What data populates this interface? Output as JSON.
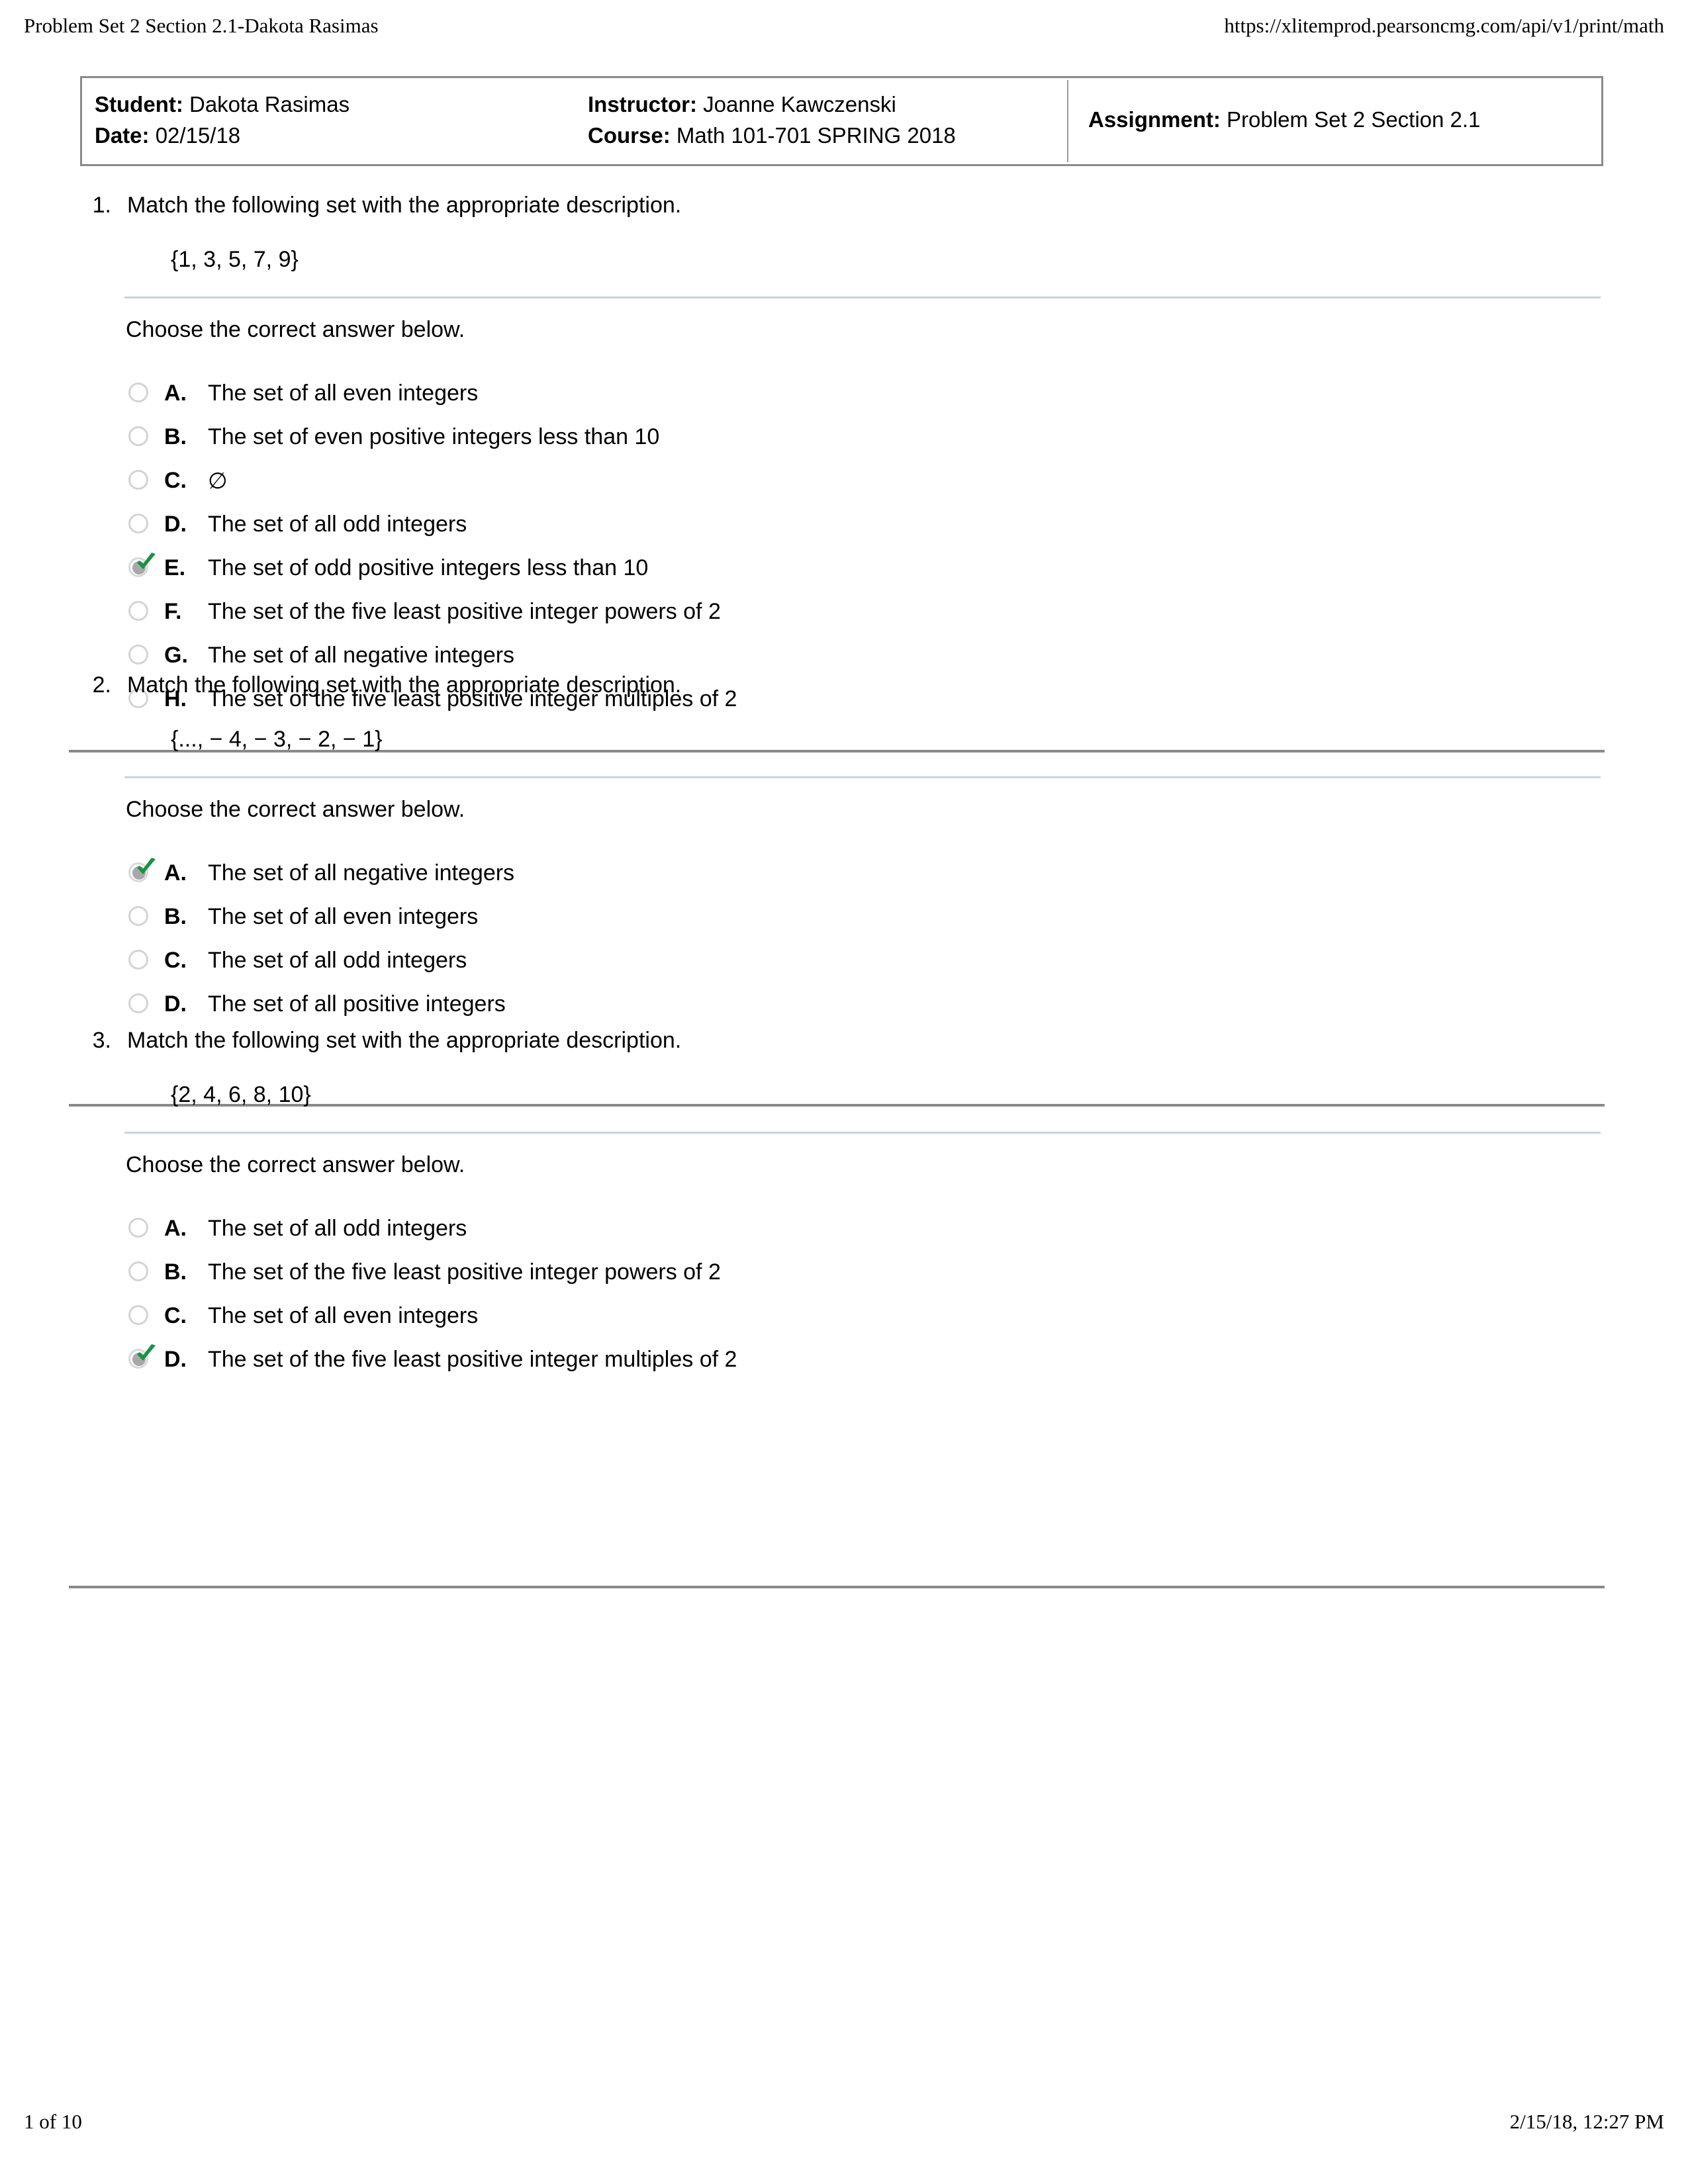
{
  "print_header": {
    "left_title": "Problem Set 2 Section 2.1-Dakota Rasimas",
    "right_url": "https://xlitemprod.pearsoncmg.com/api/v1/print/math"
  },
  "info_box": {
    "student_label": "Student:",
    "student_value": "Dakota Rasimas",
    "date_label": "Date:",
    "date_value": "02/15/18",
    "instructor_label": "Instructor:",
    "instructor_value": "Joanne Kawczenski",
    "course_label": "Course:",
    "course_value": "Math 101-701 SPRING 2018",
    "assignment_label": "Assignment:",
    "assignment_value": "Problem Set 2 Section 2.1"
  },
  "choose_prompt": "Choose the correct answer below.",
  "questions": [
    {
      "number": "1.",
      "prompt": "Match the following set with the appropriate description.",
      "set_notation": "{1, 3, 5, 7, 9}",
      "choose": "Choose the correct answer below.",
      "options": [
        {
          "letter": "A.",
          "text": "The set of all even integers",
          "selected": false
        },
        {
          "letter": "B.",
          "text": "The set of even positive integers less than 10",
          "selected": false
        },
        {
          "letter": "C.",
          "text": "∅",
          "selected": false
        },
        {
          "letter": "D.",
          "text": "The set of all odd integers",
          "selected": false
        },
        {
          "letter": "E.",
          "text": "The set of odd positive integers less than 10",
          "selected": true
        },
        {
          "letter": "F.",
          "text": "The set of the five least positive integer powers of 2",
          "selected": false
        },
        {
          "letter": "G.",
          "text": "The set of all negative integers",
          "selected": false
        },
        {
          "letter": "H.",
          "text": "The set of the five least positive integer multiples of 2",
          "selected": false
        }
      ]
    },
    {
      "number": "2.",
      "prompt": "Match the following set with the appropriate description.",
      "set_notation": "{..., − 4, − 3, − 2, − 1}",
      "choose": "Choose the correct answer below.",
      "options": [
        {
          "letter": "A.",
          "text": "The set of all negative integers",
          "selected": true
        },
        {
          "letter": "B.",
          "text": "The set of all even integers",
          "selected": false
        },
        {
          "letter": "C.",
          "text": "The set of all odd integers",
          "selected": false
        },
        {
          "letter": "D.",
          "text": "The set of all positive integers",
          "selected": false
        }
      ]
    },
    {
      "number": "3.",
      "prompt": "Match the following set with the appropriate description.",
      "set_notation": "{2, 4, 6, 8, 10}",
      "choose": "Choose the correct answer below.",
      "options": [
        {
          "letter": "A.",
          "text": "The set of all odd integers",
          "selected": false
        },
        {
          "letter": "B.",
          "text": "The set of the five least positive integer powers of 2",
          "selected": false
        },
        {
          "letter": "C.",
          "text": "The set of all even integers",
          "selected": false
        },
        {
          "letter": "D.",
          "text": "The set of the five least positive integer multiples of 2",
          "selected": true
        }
      ]
    }
  ],
  "print_footer": {
    "page_indicator": "1 of 10",
    "timestamp": "2/15/18, 12:27 PM"
  },
  "colors": {
    "check_green": "#1a9245",
    "radio_ring": "#d4d4d4",
    "radio_dot": "#a8a8a8",
    "thin_rule": "#ccd2de",
    "section_rule": "#8a8a8a",
    "box_border": "#8a8a8a"
  }
}
